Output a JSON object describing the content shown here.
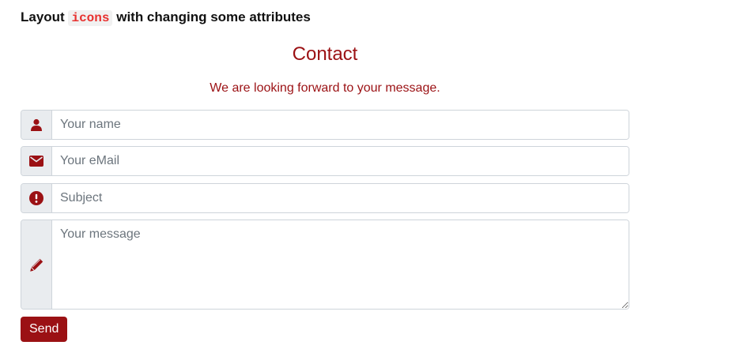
{
  "heading": {
    "prefix": "Layout",
    "code": "icons",
    "suffix": "with changing some attributes"
  },
  "form": {
    "title": "Contact",
    "subtitle": "We are looking forward to your message.",
    "fields": {
      "name_placeholder": "Your name",
      "email_placeholder": "Your eMail",
      "subject_placeholder": "Subject",
      "message_placeholder": "Your message"
    },
    "icons": {
      "name": "user-icon",
      "email": "envelope-icon",
      "subject": "exclamation-circle-icon",
      "message": "pencil-icon"
    },
    "send_label": "Send"
  },
  "colors": {
    "accent": "#9b1114",
    "code_text": "#e8312f",
    "addon_bg": "#e9ecef"
  }
}
